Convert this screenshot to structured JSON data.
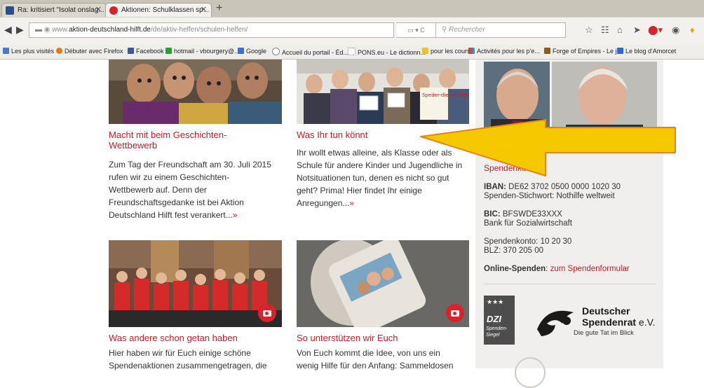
{
  "browser": {
    "tabs": [
      {
        "label": "Ra: kritisiert \"Isolat onslag..."
      },
      {
        "label": "Aktionen: Schulklassen sp..."
      }
    ],
    "url_prefix": "www.",
    "url_domain": "aktion-deutschland-hilft.de",
    "url_path": "/de/aktiv-helfen/schulen-helfen/",
    "search_placeholder": "Rechercher",
    "bookmarks": [
      "Les plus visités",
      "Débuter avec Firefox",
      "Facebook",
      "hotmail - vbourgery@...",
      "Google",
      "Accueil du portail - Éd...",
      "PONS.eu - Le dictionn...",
      "pour les cours",
      "Activités pour les p'e...",
      "Forge of Empires - Le j...",
      "Le blog d'Amorcet"
    ]
  },
  "articles": [
    {
      "title_l1": "Macht mit beim Geschichten-",
      "title_l2": "Wettbewerb",
      "lines": [
        "Zum Tag der Freundschaft am 30. Juli 2015",
        "rufen wir zu einem Geschichten-",
        "Wettbewerb auf. Denn der",
        "Freundschaftsgedanke ist bei Aktion",
        "Deutschland Hilft fest verankert..."
      ],
      "more": "»"
    },
    {
      "title_l1": "Was Ihr tun könnt",
      "lines": [
        "Ihr wollt etwas alleine, als Klasse oder als",
        "Schule für andere Kinder und Jugendliche in",
        "Notsituationen tun, denen es nicht so gut",
        "geht? Prima! Hier findet Ihr einige",
        "Anregungen..."
      ],
      "more": "»"
    },
    {
      "title_l1": "Was andere schon getan haben",
      "lines": [
        "Hier haben wir für Euch einige schöne",
        "Spendenaktionen zusammengetragen, die"
      ]
    },
    {
      "title_l1": "So unterstützen wir Euch",
      "lines": [
        "Von Euch kommt die Idee, von uns ein",
        "wenig Hilfe für den Anfang: Sammeldosen"
      ]
    }
  ],
  "photo_captions": {
    "sign_text": "Speder-die Ad- kommen"
  },
  "sidebar": {
    "heading": "Spendenkonto",
    "iban_label": "IBAN:",
    "iban": "DE62 3702 0500 0000 1020 30",
    "stichwort": "Spenden-Stichwort: Nothilfe weltweit",
    "bic_label": "BIC:",
    "bic": "BFSWDE33XXX",
    "bank": "Bank für Sozialwirtschaft",
    "konto": "Spendenkonto: 10 20 30",
    "blz": "BLZ: 370 205 00",
    "online_label": "Online-Spenden",
    "online_link": "zum Spendenformular",
    "dzi_l1": "DZI",
    "dzi_l2": "Spenden-",
    "dzi_l3": "Siegel",
    "spendenrat_l1": "Deutscher",
    "spendenrat_l2": "Spendenrat",
    "spendenrat_ev": "e.V.",
    "spendenrat_tag": "Die gute Tat im Blick"
  },
  "colors": {
    "accent_red": "#cc1c22",
    "arrow_fill": "#f5c800",
    "arrow_stroke": "#e8801a",
    "sidebar_bg": "#f0efed"
  }
}
